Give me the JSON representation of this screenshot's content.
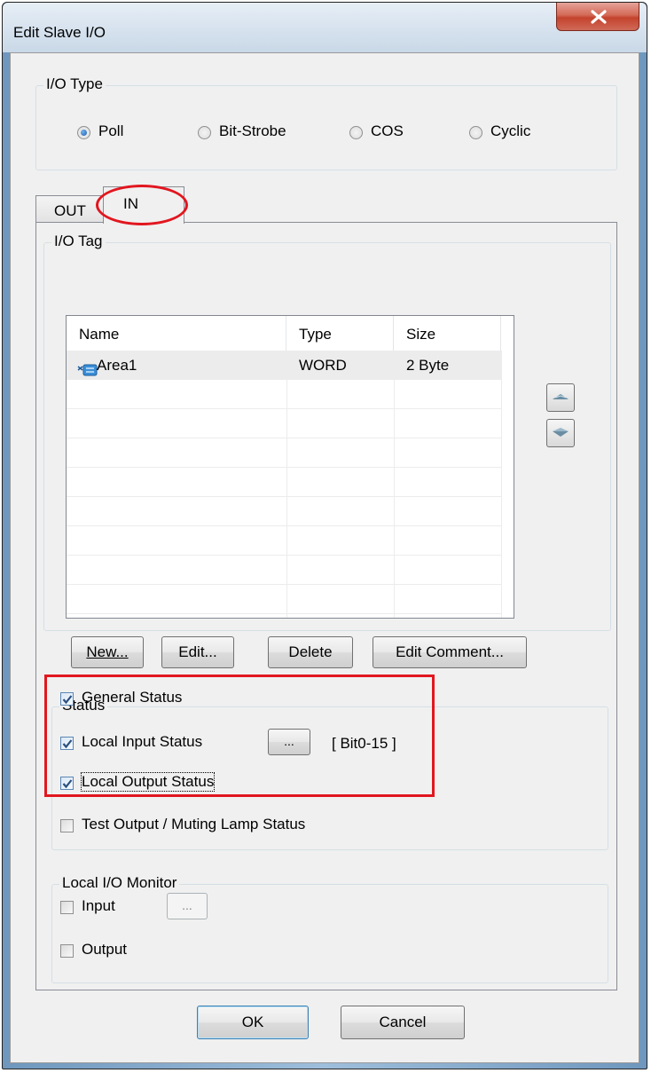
{
  "window": {
    "title": "Edit Slave I/O"
  },
  "io_type": {
    "label": "I/O Type",
    "options": [
      "Poll",
      "Bit-Strobe",
      "COS",
      "Cyclic"
    ],
    "selected": "Poll"
  },
  "tabs": {
    "out": "OUT",
    "in": "IN",
    "active": "IN"
  },
  "io_tag": {
    "label": "I/O Tag",
    "columns": [
      "Name",
      "Type",
      "Size"
    ],
    "rows": [
      {
        "name": "Area1",
        "type": "WORD",
        "size": "2 Byte",
        "icon": "tag-icon"
      }
    ],
    "buttons": {
      "new": "New...",
      "edit": "Edit...",
      "delete": "Delete",
      "edit_comment": "Edit Comment..."
    },
    "move_icons": [
      "move-up-icon",
      "move-down-icon"
    ]
  },
  "status": {
    "label": "Status",
    "general": "General Status",
    "local_input": "Local Input Status",
    "local_input_button": "...",
    "bit_range": "[ Bit0-15 ]",
    "local_output": "Local Output Status",
    "test_output": "Test Output / Muting Lamp Status",
    "checked": {
      "general": true,
      "local_input": true,
      "local_output": true,
      "test_output": false
    }
  },
  "monitor": {
    "label": "Local I/O Monitor",
    "input": "Input",
    "input_button": "...",
    "output": "Output",
    "checked": {
      "input": false,
      "output": false
    }
  },
  "footer": {
    "ok": "OK",
    "cancel": "Cancel"
  },
  "colors": {
    "highlight": "#e2161f",
    "selected_row": "#ececec"
  }
}
